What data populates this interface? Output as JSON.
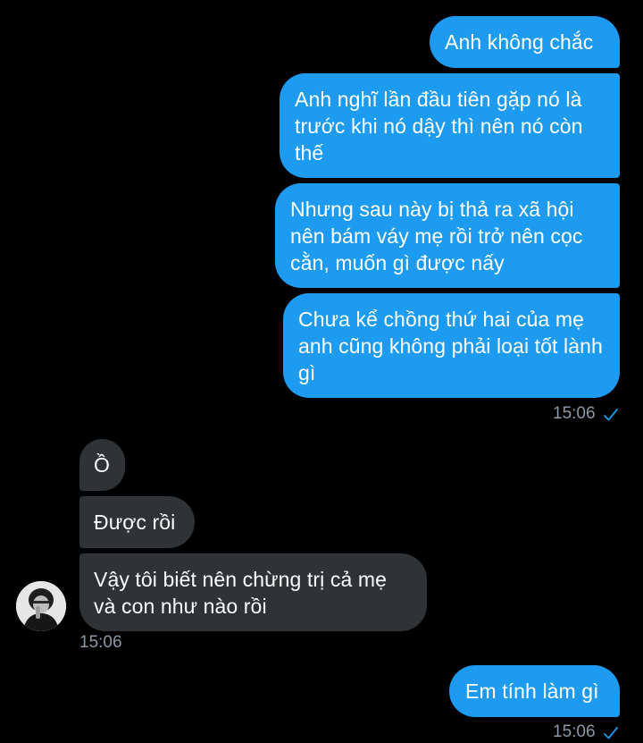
{
  "messages": {
    "out1": "Anh không chắc",
    "out2": "Anh nghĩ lần đầu tiên gặp nó là trước khi nó dậy thì nên nó còn thế",
    "out3": "Nhưng sau này bị thả ra xã hội nên bám váy mẹ rồi trở nên cọc cằn, muốn gì được nấy",
    "out4": "Chưa kể chồng thứ hai của mẹ anh cũng không phải loại tốt lành gì",
    "in1": "Ồ",
    "in2": "Được rồi",
    "in3": "Vậy tôi biết nên chừng trị cả mẹ và con như nào rồi",
    "out5": "Em tính làm gì"
  },
  "timestamps": {
    "out_group1": "15:06",
    "in_group": "15:06",
    "out_group2": "15:06"
  },
  "colors": {
    "outgoing_bubble": "#1d9bf0",
    "incoming_bubble": "#2f3336",
    "background": "#000000",
    "timestamp": "#8b98a5"
  },
  "icons": {
    "read_receipt": "check-icon",
    "avatar": "user-avatar"
  }
}
